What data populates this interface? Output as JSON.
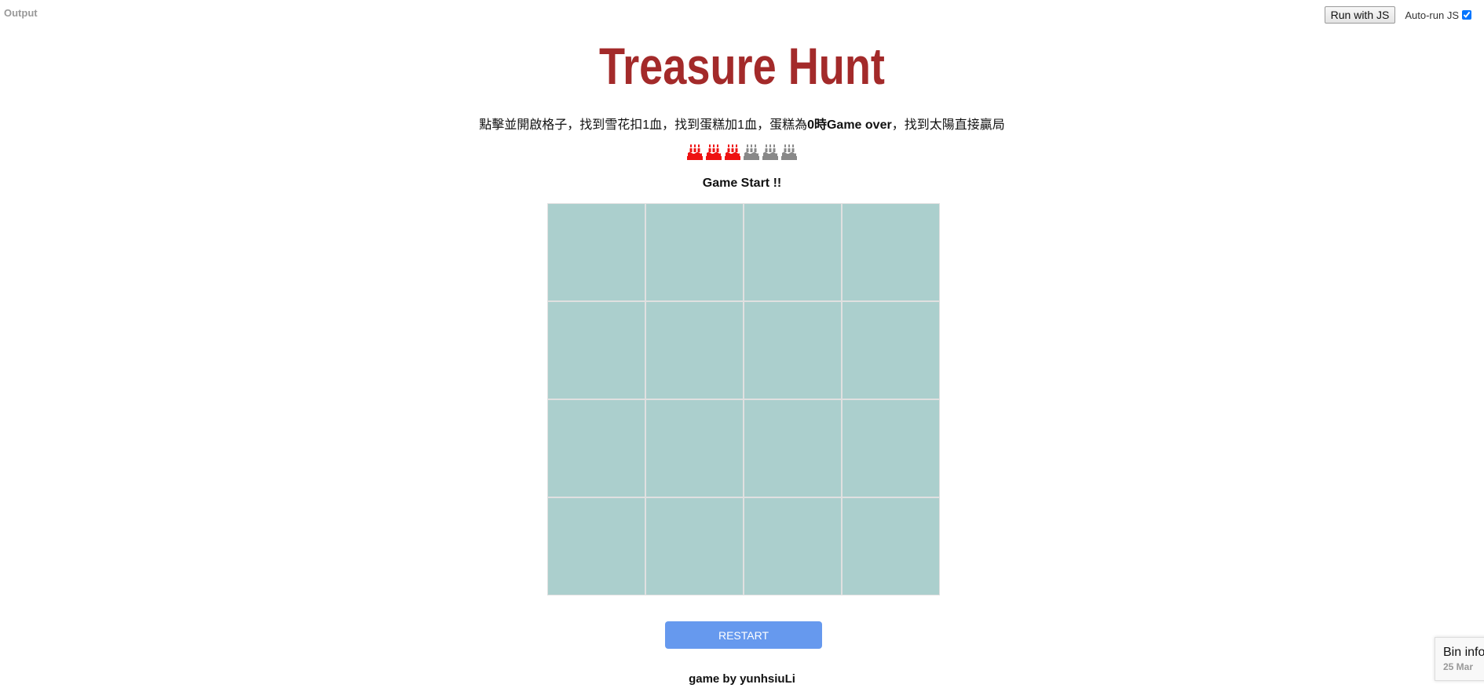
{
  "editor": {
    "output_label": "Output",
    "run_button": "Run with JS",
    "autorun_label": "Auto-run JS",
    "autorun_checked": true
  },
  "game": {
    "title": "Treasure Hunt",
    "instructions": {
      "part1": "點擊並開啟格子，找到雪花扣1血，找到蛋糕加1血，蛋糕為",
      "part2": "0時Game over",
      "part3": "，找到太陽直接贏局"
    },
    "lives": {
      "total": 6,
      "active": 3,
      "icon": "cake-icon",
      "active_color": "#ee1111",
      "inactive_color": "#888888"
    },
    "status": "Game Start !!",
    "board": {
      "rows": 4,
      "cols": 4,
      "cell_color": "#abcfcd"
    },
    "restart_label": "RESTART",
    "credit": "game by yunhsiuLi"
  },
  "bin_info": {
    "title": "Bin info",
    "date": "25 Mar"
  },
  "colors": {
    "title": "#a32a2a",
    "restart_button": "#6699ee"
  }
}
